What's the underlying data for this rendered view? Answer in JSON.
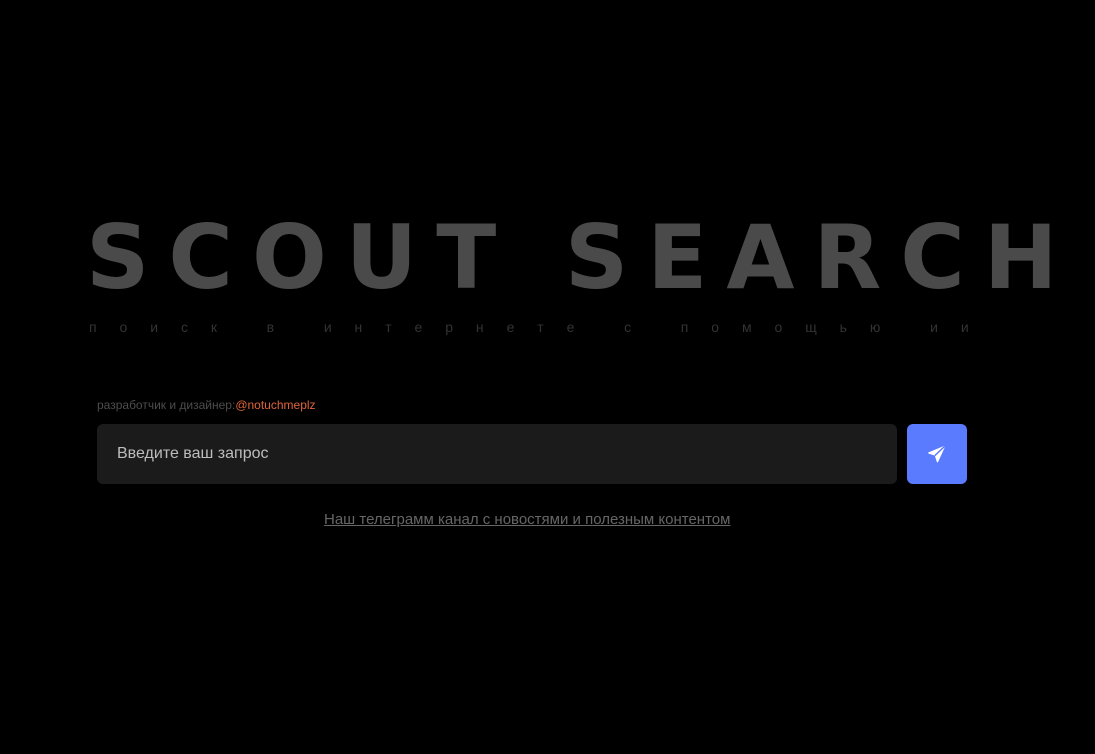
{
  "hero": {
    "title": "SCOUT SEARCH",
    "subtitle_letters": [
      "п",
      "о",
      "и",
      "с",
      "к",
      " ",
      "в",
      " ",
      "и",
      "н",
      "т",
      "е",
      "р",
      "н",
      "е",
      "т",
      "е",
      " ",
      "с",
      " ",
      "п",
      "о",
      "м",
      "о",
      "щ",
      "ь",
      "ю",
      " ",
      "и",
      "и"
    ]
  },
  "credit": {
    "label": "разработчик и дизайнер:",
    "handle": "@notuchmeplz",
    "handle_color": "#e0643a"
  },
  "search": {
    "placeholder": "Введите ваш запрос",
    "value": "",
    "send_icon": "send-paper-plane-icon",
    "accent_color": "#5b7bff"
  },
  "footer": {
    "telegram_link": "Наш телеграмм канал с новостями и полезным контентом"
  }
}
